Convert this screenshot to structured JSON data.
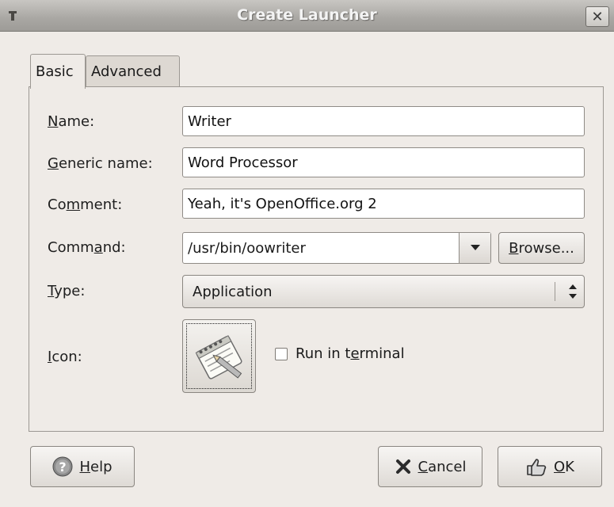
{
  "window": {
    "title": "Create Launcher",
    "close_glyph": "✕"
  },
  "tabs": [
    {
      "label": "Basic",
      "active": true
    },
    {
      "label": "Advanced",
      "active": false
    }
  ],
  "form": {
    "name": {
      "label_pre": "",
      "label_u": "N",
      "label_post": "ame:",
      "value": "Writer"
    },
    "generic_name": {
      "label_pre": "",
      "label_u": "G",
      "label_post": "eneric name:",
      "value": "Word Processor"
    },
    "comment": {
      "label_pre": "Co",
      "label_u": "m",
      "label_post": "ment:",
      "value": "Yeah, it's OpenOffice.org 2"
    },
    "command": {
      "label_pre": "Comm",
      "label_u": "a",
      "label_post": "nd:",
      "value": "/usr/bin/oowriter"
    },
    "browse": {
      "label_u": "B",
      "label_post": "rowse..."
    },
    "type": {
      "label_pre": "",
      "label_u": "T",
      "label_post": "ype:",
      "value": "Application"
    },
    "icon": {
      "label_pre": "",
      "label_u": "I",
      "label_post": "con:",
      "icon_name": "notepad-pencil-icon"
    },
    "run_in_terminal": {
      "label_pre": "Run in t",
      "label_u": "e",
      "label_post": "rminal",
      "checked": false
    }
  },
  "buttons": {
    "help": {
      "label_u": "H",
      "label_post": "elp"
    },
    "cancel": {
      "label_u": "C",
      "label_post": "ancel"
    },
    "ok": {
      "label_u": "O",
      "label_post": "K"
    }
  }
}
